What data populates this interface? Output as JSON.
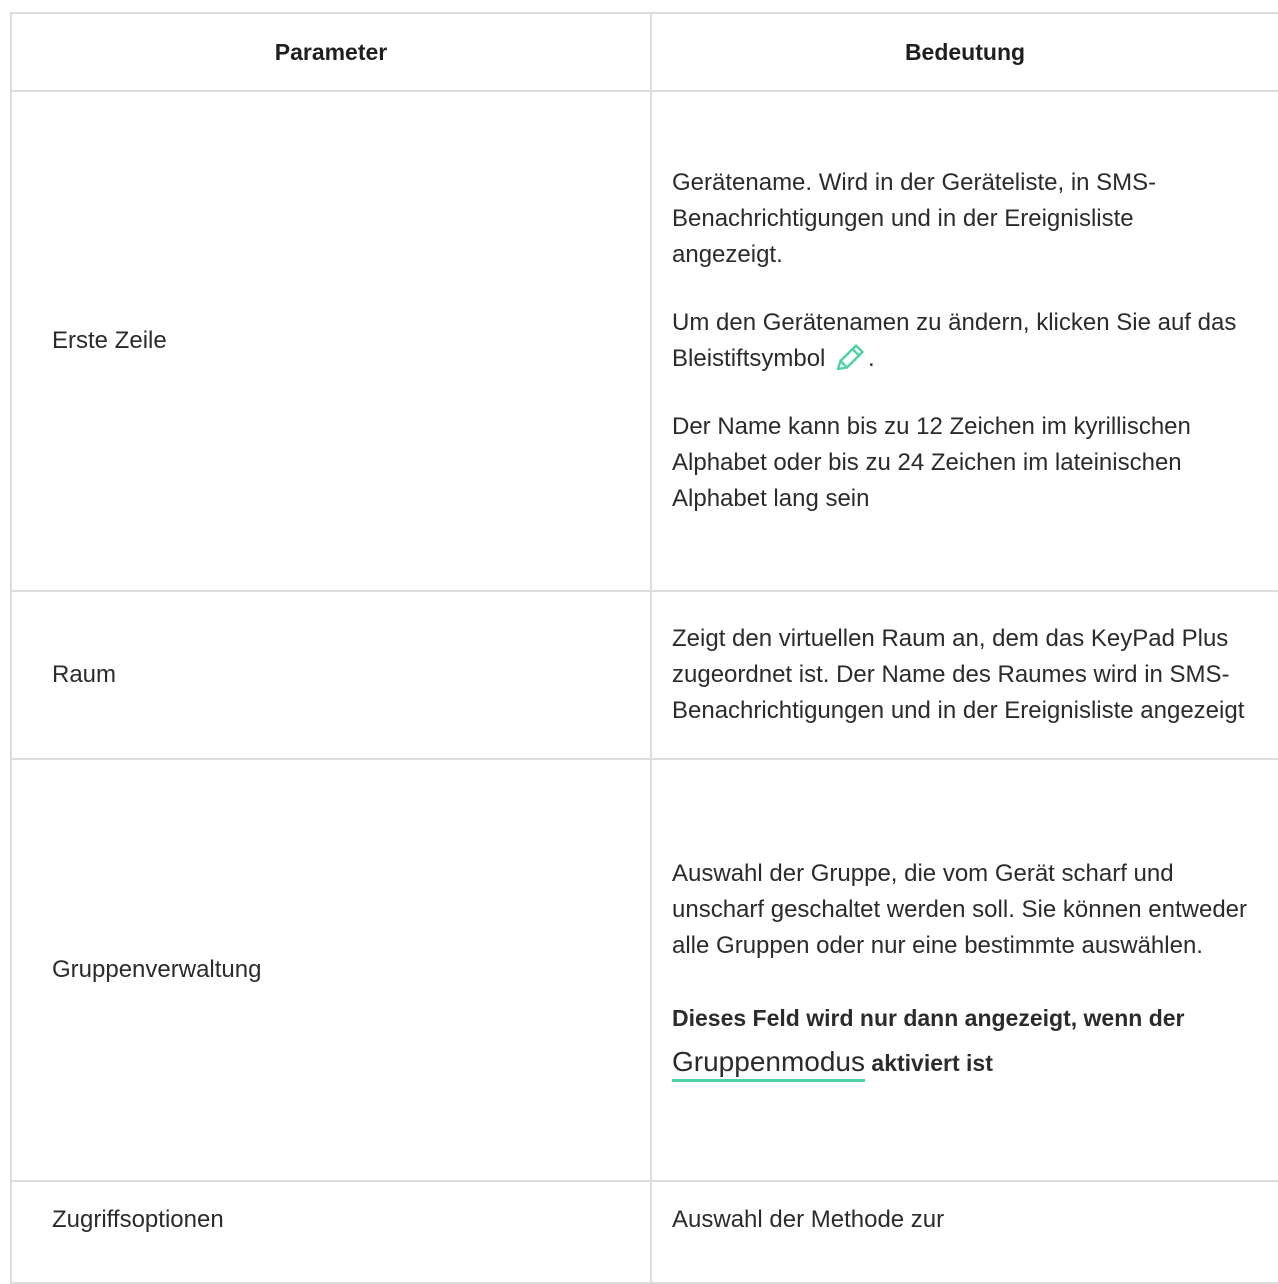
{
  "header": {
    "col1": "Parameter",
    "col2": "Bedeutung"
  },
  "rows": [
    {
      "param": "Erste Zeile",
      "p1": "Gerätename. Wird in der Geräteliste, in SMS-Benachrichtigungen und in der Ereignisliste angezeigt.",
      "p2_before": "Um den Gerätenamen zu ändern, klicken Sie auf das Bleistiftsymbol",
      "p2_after": ".",
      "p3": "Der Name kann bis zu 12 Zeichen im kyrillischen Alphabet oder bis zu 24 Zeichen im lateinischen Alphabet lang sein"
    },
    {
      "param": "Raum",
      "p1": "Zeigt den virtuellen Raum an, dem das KeyPad Plus zugeordnet ist. Der Name des Raumes wird in SMS-Benachrichtigungen und in der Ereignisliste angezeigt"
    },
    {
      "param": "Gruppenverwaltung",
      "p1": "Auswahl der Gruppe, die vom Gerät scharf und unscharf geschaltet werden soll. Sie können entweder alle Gruppen oder nur eine bestimmte auswählen.",
      "note_before": "Dieses Feld wird nur dann angezeigt, wenn der",
      "note_link": "Gruppenmodus",
      "note_after": "aktiviert ist"
    },
    {
      "param": "Zugriffsoptionen",
      "p1": "Auswahl der Methode zur"
    }
  ],
  "icons": {
    "pencil": "pencil-icon"
  },
  "colors": {
    "accent": "#4fd1a1",
    "border": "#dcdcdc",
    "text": "#2b2b2b"
  }
}
